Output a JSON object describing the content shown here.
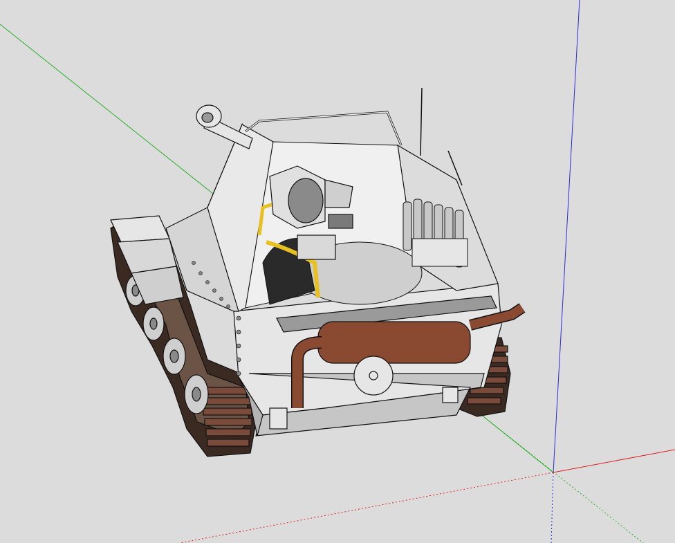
{
  "viewport": {
    "background": "#dcdcdc",
    "axes": {
      "red": "#e02020",
      "green": "#22b022",
      "blue": "#2a2ad8"
    }
  },
  "model": {
    "hull_color": "#e6e6e6",
    "shadow_color": "#b4b4b4",
    "track_color": "#3a2a22",
    "track_link_color": "#7a4a3a",
    "exhaust_color": "#8a4a32",
    "hose_color": "#e8c020",
    "outline_color": "#111111"
  }
}
